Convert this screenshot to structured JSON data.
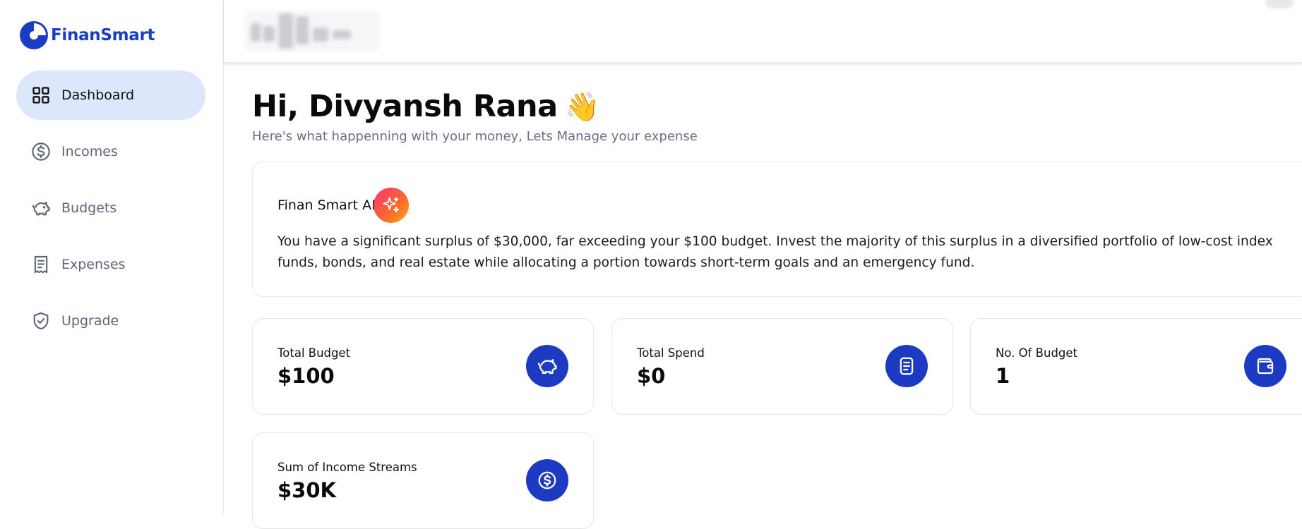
{
  "brand": {
    "name": "FinanSmart",
    "accent": "#1b3cc4"
  },
  "sidebar": {
    "items": [
      {
        "label": "Dashboard",
        "icon": "grid-icon",
        "active": true
      },
      {
        "label": "Incomes",
        "icon": "dollar-circle-icon",
        "active": false
      },
      {
        "label": "Budgets",
        "icon": "piggy-bank-icon",
        "active": false
      },
      {
        "label": "Expenses",
        "icon": "receipt-icon",
        "active": false
      },
      {
        "label": "Upgrade",
        "icon": "shield-check-icon",
        "active": false
      }
    ]
  },
  "header": {
    "greeting": "Hi, Divyansh Rana",
    "greeting_emoji": "👋",
    "subtitle": "Here's what happenning with your money, Lets Manage your expense"
  },
  "ai_card": {
    "title": "Finan Smart AI",
    "icon": "sparkles-icon",
    "message": "You have a significant surplus of $30,000, far exceeding your $100 budget. Invest the majority of this surplus in a diversified portfolio of low-cost index funds, bonds, and real estate while allocating a portion towards short-term goals and an emergency fund."
  },
  "stats": [
    {
      "label": "Total Budget",
      "value": "$100",
      "icon": "piggy-bank-icon"
    },
    {
      "label": "Total Spend",
      "value": "$0",
      "icon": "receipt-icon"
    },
    {
      "label": "No. Of Budget",
      "value": "1",
      "icon": "wallet-icon"
    },
    {
      "label": "Sum of Income Streams",
      "value": "$30K",
      "icon": "dollar-circle-icon"
    }
  ]
}
